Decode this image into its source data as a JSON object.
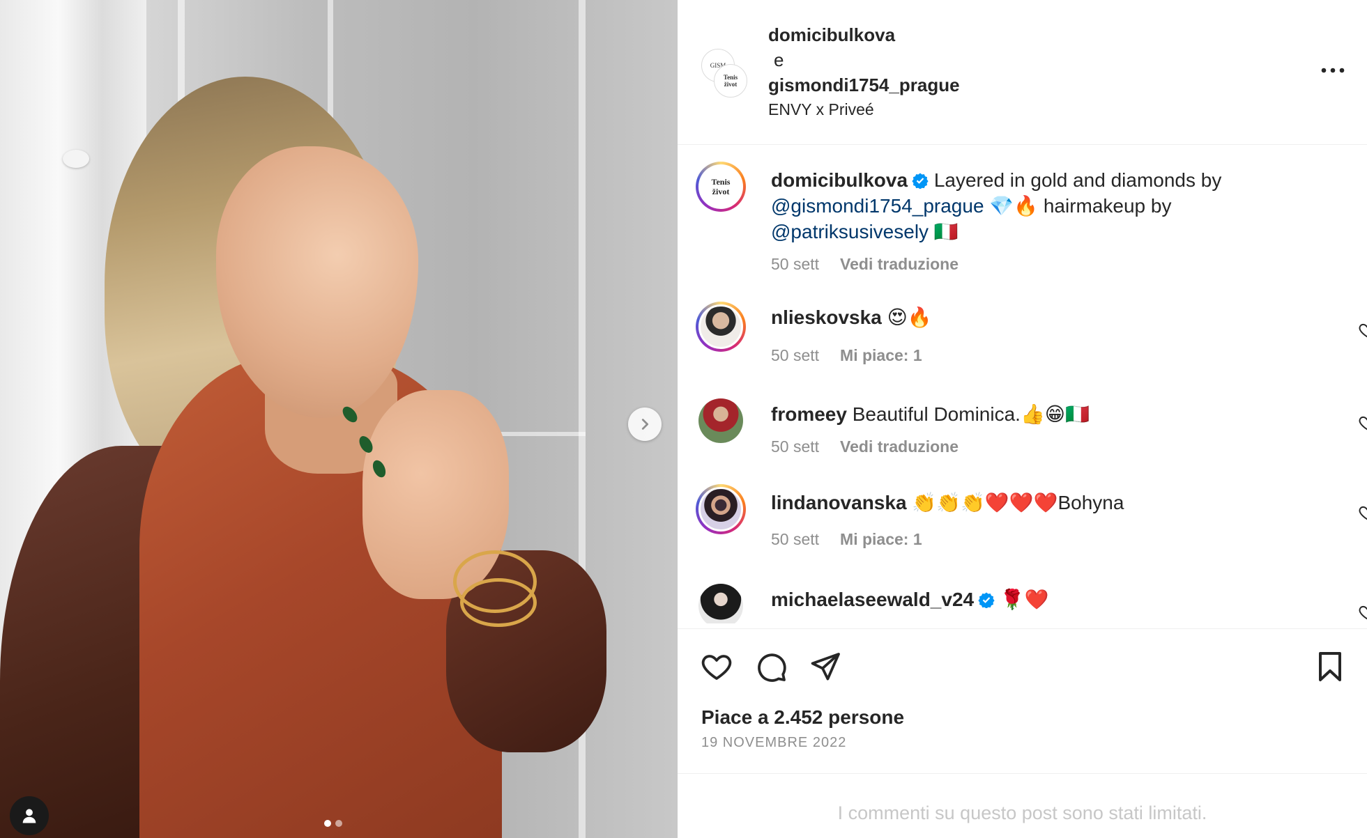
{
  "header": {
    "author1": "domicibulkova",
    "conjunction": "e",
    "author2": "gismondi1754_prague",
    "subtitle": "ENVY x Priveé",
    "avatar_text_1": "GISM",
    "avatar_text_2": "Tenis\nživot"
  },
  "caption": {
    "username": "domicibulkova",
    "text_1": "Layered in gold and diamonds by",
    "mention_1": "@gismondi1754_prague",
    "emoji_1": "💎🔥",
    "text_2": "hairmakeup by",
    "mention_2": "@patriksusivesely",
    "emoji_2": "🇮🇹",
    "time": "50 sett",
    "translate": "Vedi traduzione",
    "avatar_text": "Tenis\nživot"
  },
  "comments": [
    {
      "username": "nlieskovska",
      "text": "😍🔥",
      "time": "50 sett",
      "action": "Mi piace: 1"
    },
    {
      "username": "fromeey",
      "text": "Beautiful Dominica.👍😁🇮🇹",
      "time": "50 sett",
      "action": "Vedi traduzione"
    },
    {
      "username": "lindanovanska",
      "text": "👏👏👏❤️❤️❤️Bohyna",
      "time": "50 sett",
      "action": "Mi piace: 1"
    },
    {
      "username": "michaelaseewald_v24",
      "text": "🌹❤️"
    }
  ],
  "likes": "Piace a 2.452 persone",
  "date": "19 NOVEMBRE 2022",
  "limited_notice": "I commenti su questo post sono stati limitati.",
  "colors": {
    "verified": "#0095f6",
    "link": "#00376b",
    "muted": "#8e8e8e",
    "divider": "#efefef"
  },
  "icons": [
    "next-arrow-icon",
    "user-tag-icon",
    "more-icon",
    "verified-icon",
    "heart-icon",
    "comment-icon",
    "share-icon",
    "bookmark-icon"
  ]
}
